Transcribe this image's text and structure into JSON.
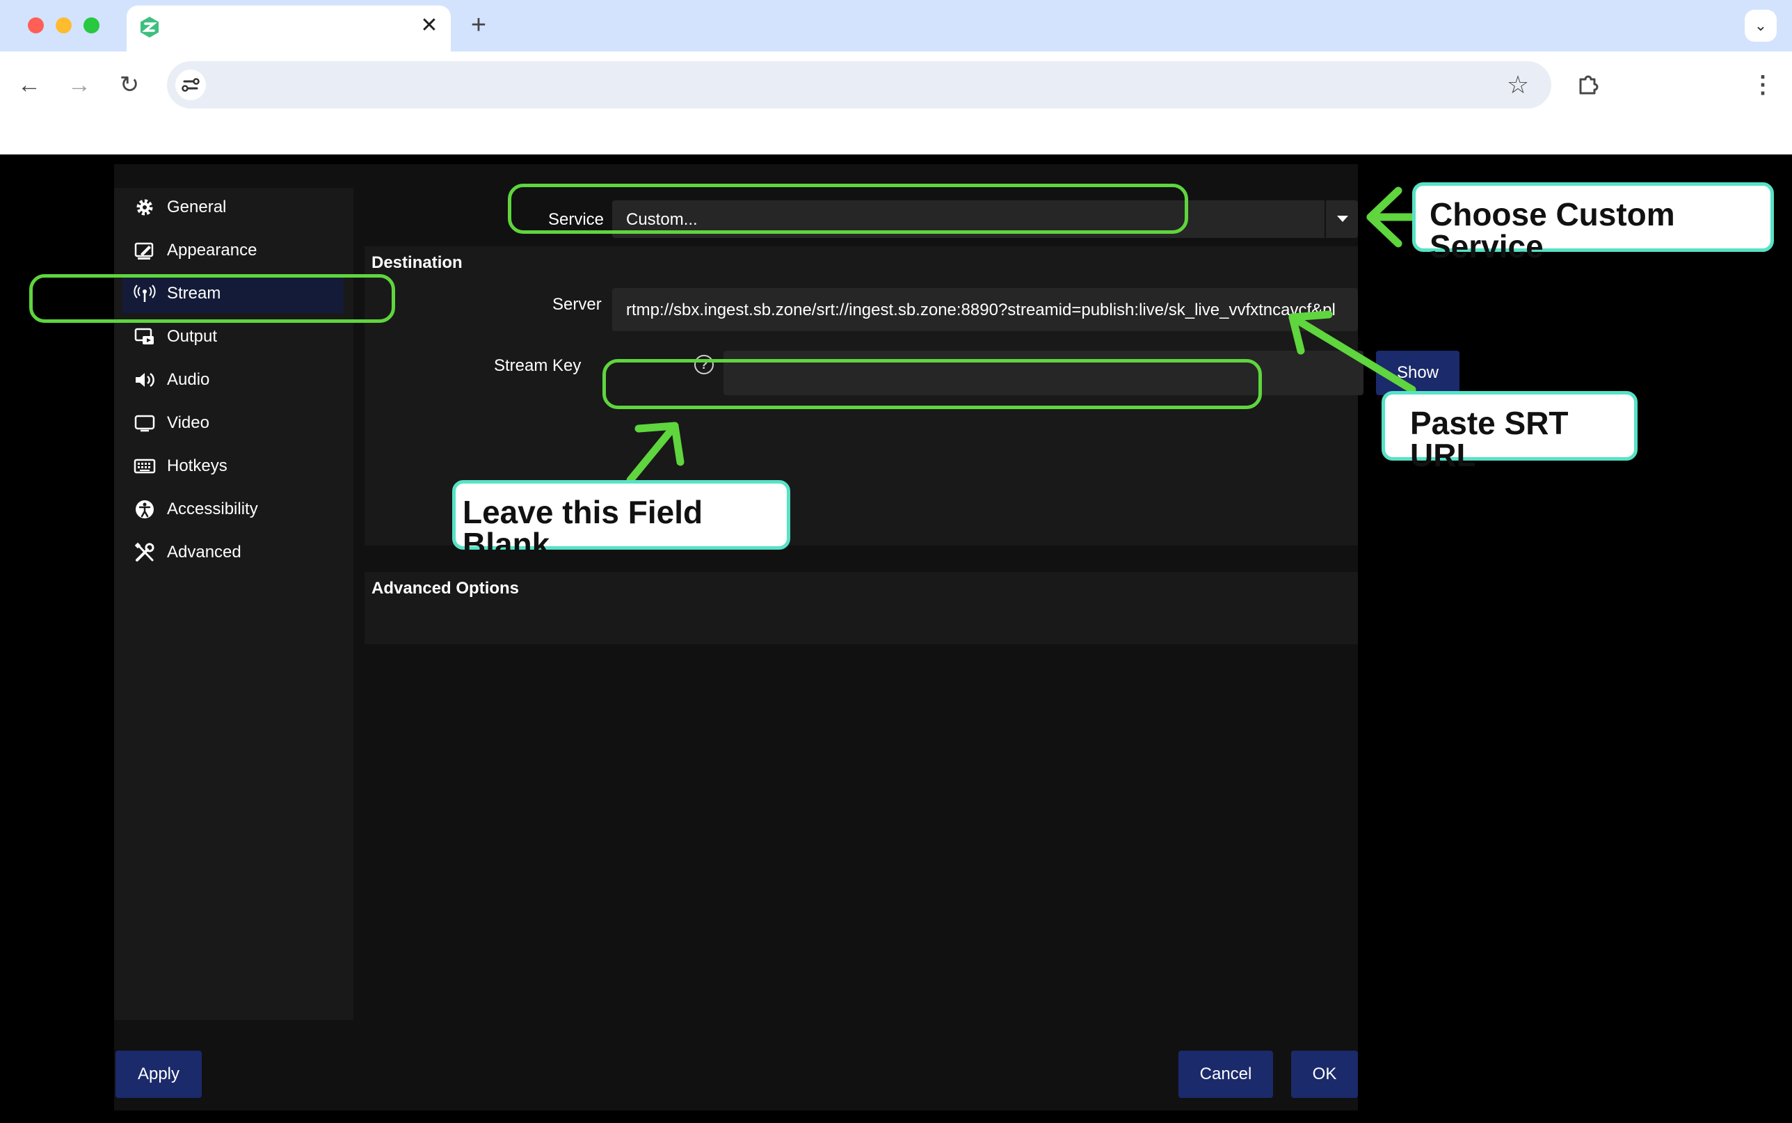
{
  "browser": {
    "tab_close": "✕",
    "new_tab": "+"
  },
  "sidebar": {
    "items": [
      {
        "label": "General",
        "icon": "gear-icon"
      },
      {
        "label": "Appearance",
        "icon": "appearance-icon"
      },
      {
        "label": "Stream",
        "icon": "antenna-icon"
      },
      {
        "label": "Output",
        "icon": "output-icon"
      },
      {
        "label": "Audio",
        "icon": "speaker-icon"
      },
      {
        "label": "Video",
        "icon": "monitor-icon"
      },
      {
        "label": "Hotkeys",
        "icon": "keyboard-icon"
      },
      {
        "label": "Accessibility",
        "icon": "accessibility-icon"
      },
      {
        "label": "Advanced",
        "icon": "tools-icon"
      }
    ],
    "active": "Stream"
  },
  "stream": {
    "service_label": "Service",
    "service_value": "Custom...",
    "destination_title": "Destination",
    "server_label": "Server",
    "server_value": "rtmp://sbx.ingest.sb.zone/srt://ingest.sb.zone:8890?streamid=publish:live/sk_live_vvfxtncavcf&pl",
    "stream_key_label": "Stream Key",
    "stream_key_value": "",
    "help_glyph": "?",
    "show_label": "Show",
    "advanced_title": "Advanced Options"
  },
  "footer": {
    "apply_label": "Apply",
    "cancel_label": "Cancel",
    "ok_label": "OK"
  },
  "annotations": {
    "choose_service": "Choose Custom Service",
    "paste_url": "Paste SRT URL",
    "leave_blank": "Leave this Field Blank"
  },
  "colors": {
    "highlight": "#5fd53e",
    "callout_border": "#57e2c6",
    "button": "#1b2a6b",
    "active_item": "#141b38"
  }
}
